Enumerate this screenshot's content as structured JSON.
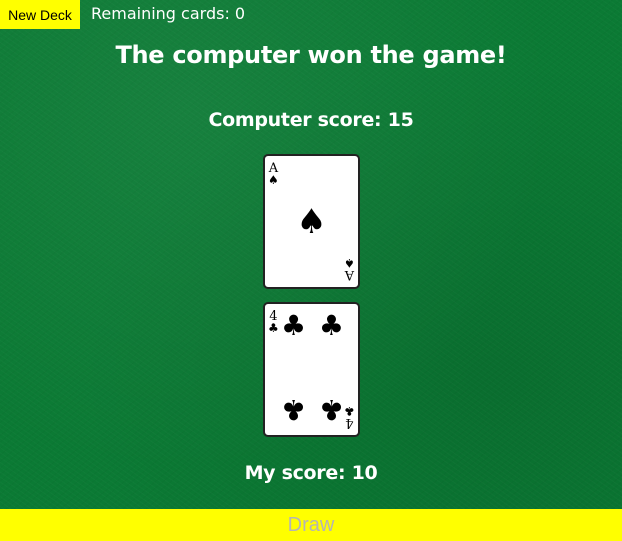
{
  "header": {
    "new_deck_label": "New Deck",
    "remaining_label": "Remaining cards: 0"
  },
  "game": {
    "result_message": "The computer won the game!",
    "computer_score_label": "Computer score: 15",
    "my_score_label": "My score: 10",
    "draw_label": "Draw"
  },
  "cards": {
    "computer": {
      "rank": "A",
      "suit": "♠",
      "suit_name": "spades-icon"
    },
    "player": {
      "rank": "4",
      "suit": "♣",
      "suit_name": "clubs-icon"
    }
  },
  "colors": {
    "table_green": "#0b7a34",
    "button_yellow": "#ffff00",
    "draw_text_disabled": "#b5b5b5",
    "text_white": "#ffffff"
  }
}
